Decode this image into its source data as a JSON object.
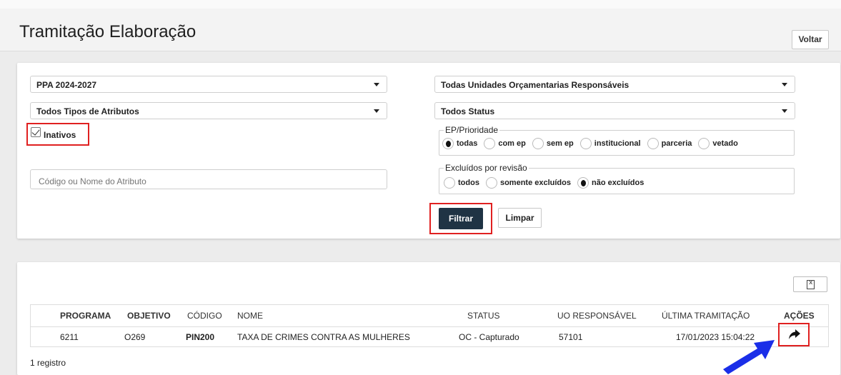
{
  "header": {
    "title": "Tramitação Elaboração",
    "back_label": "Voltar"
  },
  "filters": {
    "ppa": "PPA 2024-2027",
    "tipos_atributos": "Todos Tipos de Atributos",
    "inativos_label": "Inativos",
    "inativos_checked": true,
    "search_placeholder": "Código ou Nome do Atributo",
    "unidades": "Todas Unidades Orçamentarias Responsáveis",
    "status": "Todos Status",
    "ep_prioridade": {
      "legend": "EP/Prioridade",
      "options": [
        "todas",
        "com ep",
        "sem ep",
        "institucional",
        "parceria",
        "vetado"
      ],
      "selected": "todas"
    },
    "excluidos": {
      "legend": "Excluídos por revisão",
      "options": [
        "todos",
        "somente excluídos",
        "não excluídos"
      ],
      "selected": "não excluídos"
    },
    "filtrar_label": "Filtrar",
    "limpar_label": "Limpar"
  },
  "table": {
    "headers": [
      "PROGRAMA",
      "OBJETIVO",
      "CÓDIGO",
      "NOME",
      "STATUS",
      "UO RESPONSÁVEL",
      "ÚLTIMA TRAMITAÇÃO",
      "AÇÕES"
    ],
    "rows": [
      [
        "6211",
        "O269",
        "PIN200",
        "TAXA DE CRIMES CONTRA AS MULHERES",
        "OC - Capturado",
        "57101",
        "17/01/2023 15:04:22"
      ]
    ]
  },
  "footer": {
    "count_text": "1 registro"
  },
  "icons": {
    "export": "excel-export-icon",
    "action": "forward-arrow-icon",
    "annotation": "blue-pointer-arrow"
  },
  "colors": {
    "highlight": "#e02020",
    "primary_button": "#1f3344",
    "annotation": "#1a2ee8"
  }
}
